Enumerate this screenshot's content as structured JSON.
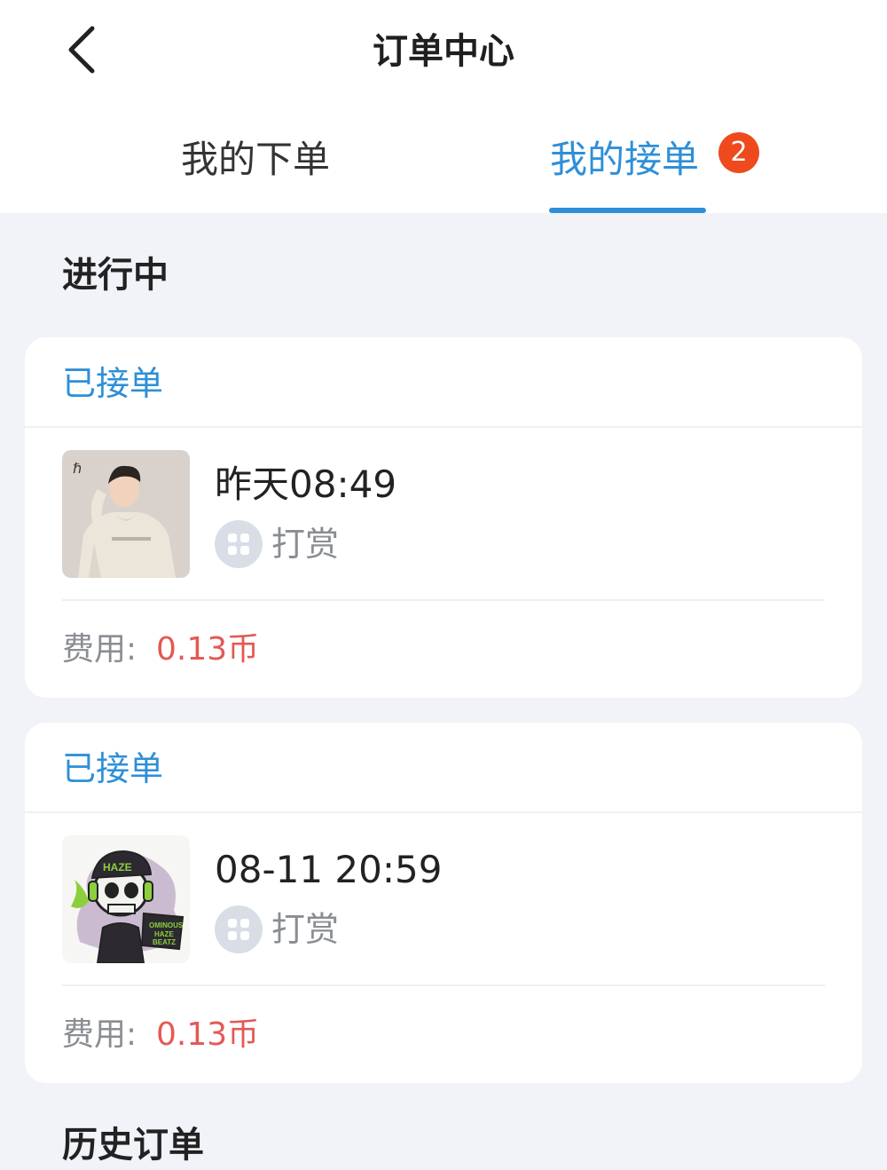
{
  "header": {
    "title": "订单中心"
  },
  "tabs": [
    {
      "label": "我的下单",
      "active": false
    },
    {
      "label": "我的接单",
      "active": true,
      "badge": "2"
    }
  ],
  "section": {
    "title": "进行中"
  },
  "orders": [
    {
      "status": "已接单",
      "time": "昨天08:49",
      "service": "打赏",
      "fee_label": "费用:",
      "fee_value": "0.13币",
      "thumbnail": "person-in-hoodie-photo"
    },
    {
      "status": "已接单",
      "time": "08-11 20:59",
      "service": "打赏",
      "fee_label": "费用:",
      "fee_value": "0.13币",
      "thumbnail": "skull-headphones-illustration"
    }
  ],
  "next_section": {
    "title": "历史订单"
  },
  "colors": {
    "accent": "#2e8fd8",
    "badge": "#ee4a1e",
    "fee": "#e25a55",
    "background": "#f1f3f8"
  }
}
